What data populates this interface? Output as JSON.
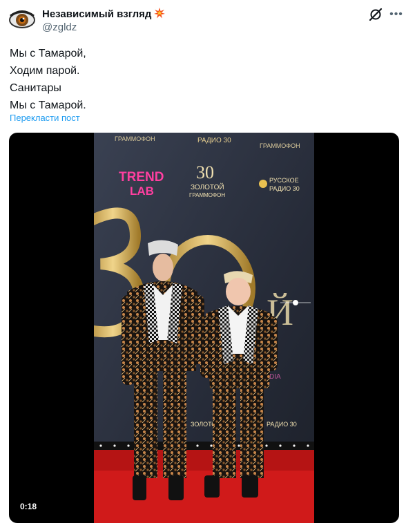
{
  "author": {
    "display_name": "Независимый взгляд",
    "handle": "@zgldz"
  },
  "tweet": {
    "lines": [
      "Мы с Тамарой,",
      "Ходим парой.",
      "Санитары",
      "Мы с Тамарой."
    ],
    "translate_label": "Перекласти пост"
  },
  "media": {
    "duration": "0:18",
    "backdrop_logos": {
      "zolotoy": "ЗОЛОТОЙ",
      "grammofon": "ГРАММОФОН",
      "russkoe": "РУССКОЕ",
      "radio": "РАДИО 30",
      "trend": "TREND",
      "lab": "LAB",
      "big_thirty": "30",
      "watermark": "@TRENDLAB_MEDIA"
    }
  },
  "colors": {
    "accent": "#1d9bf0",
    "carpet": "#d01a1a",
    "backdrop": "#2a2f3e"
  }
}
